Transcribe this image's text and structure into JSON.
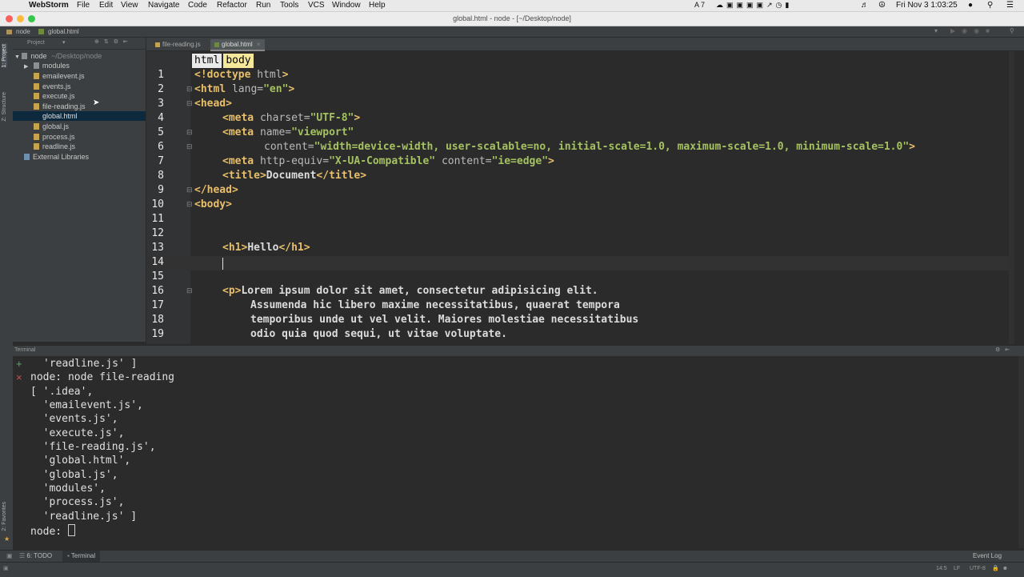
{
  "menubar": {
    "app_name": "WebStorm",
    "items": [
      "File",
      "Edit",
      "View",
      "Navigate",
      "Code",
      "Refactor",
      "Run",
      "Tools",
      "VCS",
      "Window",
      "Help"
    ],
    "clock": "Fri Nov 3  1:03:25",
    "status_count": "7"
  },
  "window": {
    "title": "global.html - node - [~/Desktop/node]"
  },
  "navbar": {
    "project": "node",
    "file": "global.html"
  },
  "left_strip": {
    "project_tab": "1: Project",
    "structure_tab": "Z: Structure",
    "favorites_tab": "2: Favorites"
  },
  "project_panel": {
    "header": "Project",
    "root_name": "node",
    "root_path": "~/Desktop/node",
    "folder": "modules",
    "files": [
      "emailevent.js",
      "events.js",
      "execute.js",
      "file-reading.js",
      "global.html",
      "global.js",
      "process.js",
      "readline.js"
    ],
    "external": "External Libraries"
  },
  "tabs": [
    "file-reading.js",
    "global.html"
  ],
  "breadcrumbs": [
    "html",
    "body"
  ],
  "editor": {
    "line_numbers": [
      "1",
      "2",
      "3",
      "4",
      "5",
      "6",
      "7",
      "8",
      "9",
      "10",
      "11",
      "12",
      "13",
      "14",
      "15",
      "16",
      "17",
      "18",
      "19"
    ],
    "lines": {
      "l1a": "<!doctype ",
      "l1b": "html",
      "l1c": ">",
      "l2a": "<html ",
      "l2b": "lang=",
      "l2c": "\"en\"",
      "l2d": ">",
      "l3": "<head>",
      "l4a": "<meta ",
      "l4b": "charset=",
      "l4c": "\"UTF-8\"",
      "l4d": ">",
      "l5a": "<meta ",
      "l5b": "name=",
      "l5c": "\"viewport\"",
      "l6b": "content=",
      "l6c": "\"width=device-width, user-scalable=no, initial-scale=1.0, maximum-scale=1.0, minimum-scale=1.0\"",
      "l6d": ">",
      "l7a": "<meta ",
      "l7b": "http-equiv=",
      "l7c": "\"X-UA-Compatible\"",
      "l7d": " content=",
      "l7e": "\"ie=edge\"",
      "l7f": ">",
      "l8a": "<title>",
      "l8b": "Document",
      "l8c": "</title>",
      "l9": "</head>",
      "l10": "<body>",
      "l13a": "<h1>",
      "l13b": "Hello",
      "l13c": "</h1>",
      "l16a": "<p>",
      "l16b": "Lorem ipsum dolor sit amet, consectetur adipisicing elit.",
      "l17": "Assumenda hic libero maxime necessitatibus, quaerat tempora",
      "l18": "temporibus unde ut vel velit. Maiores molestiae necessitatibus",
      "l19": "odio quia quod sequi, ut vitae voluptate."
    }
  },
  "terminal": {
    "title": "Terminal",
    "lines": [
      "'readline.js' ]",
      "node: node file-reading",
      "[ '.idea',",
      "  'emailevent.js',",
      "  'events.js',",
      "  'execute.js',",
      "  'file-reading.js',",
      "  'global.html',",
      "  'global.js',",
      "  'modules',",
      "  'process.js',",
      "  'readline.js' ]",
      "node: "
    ]
  },
  "bottom_tools": {
    "todo": "6: TODO",
    "terminal": "Terminal",
    "event_log": "Event Log"
  },
  "status": {
    "position": "14:5",
    "line_sep": "LF",
    "encoding": "UTF-8"
  }
}
